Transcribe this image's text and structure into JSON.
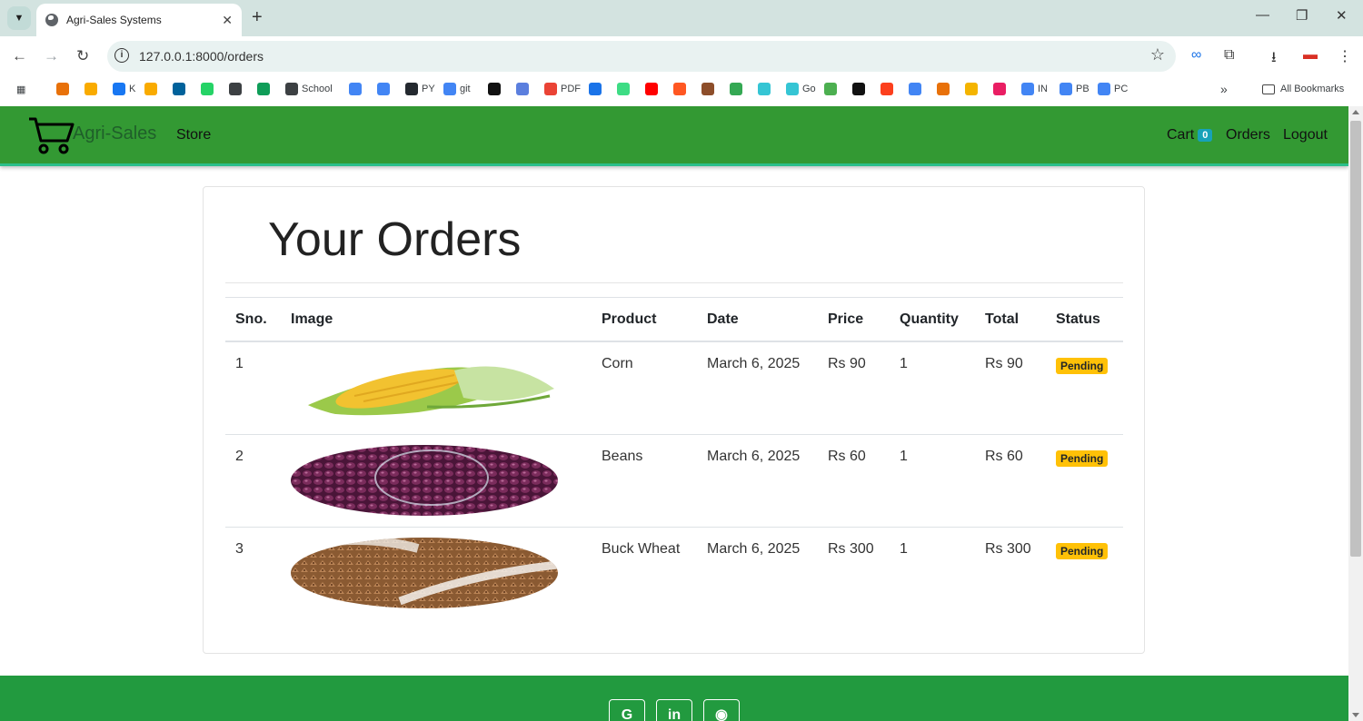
{
  "browser": {
    "tab_title": "Agri-Sales Systems",
    "url": "127.0.0.1:8000/orders",
    "bookmarks": [
      {
        "label": "",
        "color": "#e8710a"
      },
      {
        "label": "",
        "color": "#f9ab00"
      },
      {
        "label": "K",
        "color": "#1877f2"
      },
      {
        "label": "",
        "color": "#f9ab00"
      },
      {
        "label": "",
        "color": "#00629b"
      },
      {
        "label": "",
        "color": "#25d366"
      },
      {
        "label": "",
        "color": "#3c4043"
      },
      {
        "label": "",
        "color": "#0f9d58"
      },
      {
        "label": "School",
        "color": "#3c4043"
      },
      {
        "label": "",
        "color": "#4285f4"
      },
      {
        "label": "",
        "color": "#4285f4"
      },
      {
        "label": "PY",
        "color": "#24292f"
      },
      {
        "label": "git",
        "color": "#4285f4"
      },
      {
        "label": "",
        "color": "#111111"
      },
      {
        "label": "",
        "color": "#5b7fde"
      },
      {
        "label": "PDF",
        "color": "#ea4335"
      },
      {
        "label": "",
        "color": "#1a73e8"
      },
      {
        "label": "",
        "color": "#3ddc84"
      },
      {
        "label": "",
        "color": "#ff0000"
      },
      {
        "label": "",
        "color": "#ff5722"
      },
      {
        "label": "",
        "color": "#8d4e2a"
      },
      {
        "label": "",
        "color": "#34a853"
      },
      {
        "label": "",
        "color": "#35c5d4"
      },
      {
        "label": "Go",
        "color": "#35c5d4"
      },
      {
        "label": "",
        "color": "#4caf50"
      },
      {
        "label": "",
        "color": "#111111"
      },
      {
        "label": "",
        "color": "#fc3f1d"
      },
      {
        "label": "",
        "color": "#4285f4"
      },
      {
        "label": "",
        "color": "#e8710a"
      },
      {
        "label": "",
        "color": "#f4b400"
      },
      {
        "label": "",
        "color": "#e91e63"
      },
      {
        "label": "IN",
        "color": "#4285f4"
      },
      {
        "label": "PB",
        "color": "#4285f4"
      },
      {
        "label": "PC",
        "color": "#4285f4"
      }
    ],
    "all_bookmarks": "All Bookmarks",
    "overflow": "»"
  },
  "site": {
    "brand": "Agri-Sales",
    "nav_store": "Store",
    "nav_cart": "Cart",
    "cart_count": "0",
    "nav_orders": "Orders",
    "nav_logout": "Logout",
    "theme_color": "#339933"
  },
  "orders": {
    "title": "Your Orders",
    "columns": [
      "Sno.",
      "Image",
      "Product",
      "Date",
      "Price",
      "Quantity",
      "Total",
      "Status"
    ],
    "rows": [
      {
        "sno": "1",
        "product": "Corn",
        "date": "March 6, 2025",
        "price": "Rs 90",
        "quantity": "1",
        "total": "Rs 90",
        "status": "Pending",
        "image": "corn"
      },
      {
        "sno": "2",
        "product": "Beans",
        "date": "March 6, 2025",
        "price": "Rs 60",
        "quantity": "1",
        "total": "Rs 60",
        "status": "Pending",
        "image": "beans"
      },
      {
        "sno": "3",
        "product": "Buck Wheat",
        "date": "March 6, 2025",
        "price": "Rs 300",
        "quantity": "1",
        "total": "Rs 300",
        "status": "Pending",
        "image": "buckwheat"
      }
    ]
  },
  "footer": {
    "social": [
      {
        "name": "google",
        "glyph": "G"
      },
      {
        "name": "linkedin",
        "glyph": "in"
      },
      {
        "name": "github",
        "glyph": "◉"
      }
    ]
  }
}
